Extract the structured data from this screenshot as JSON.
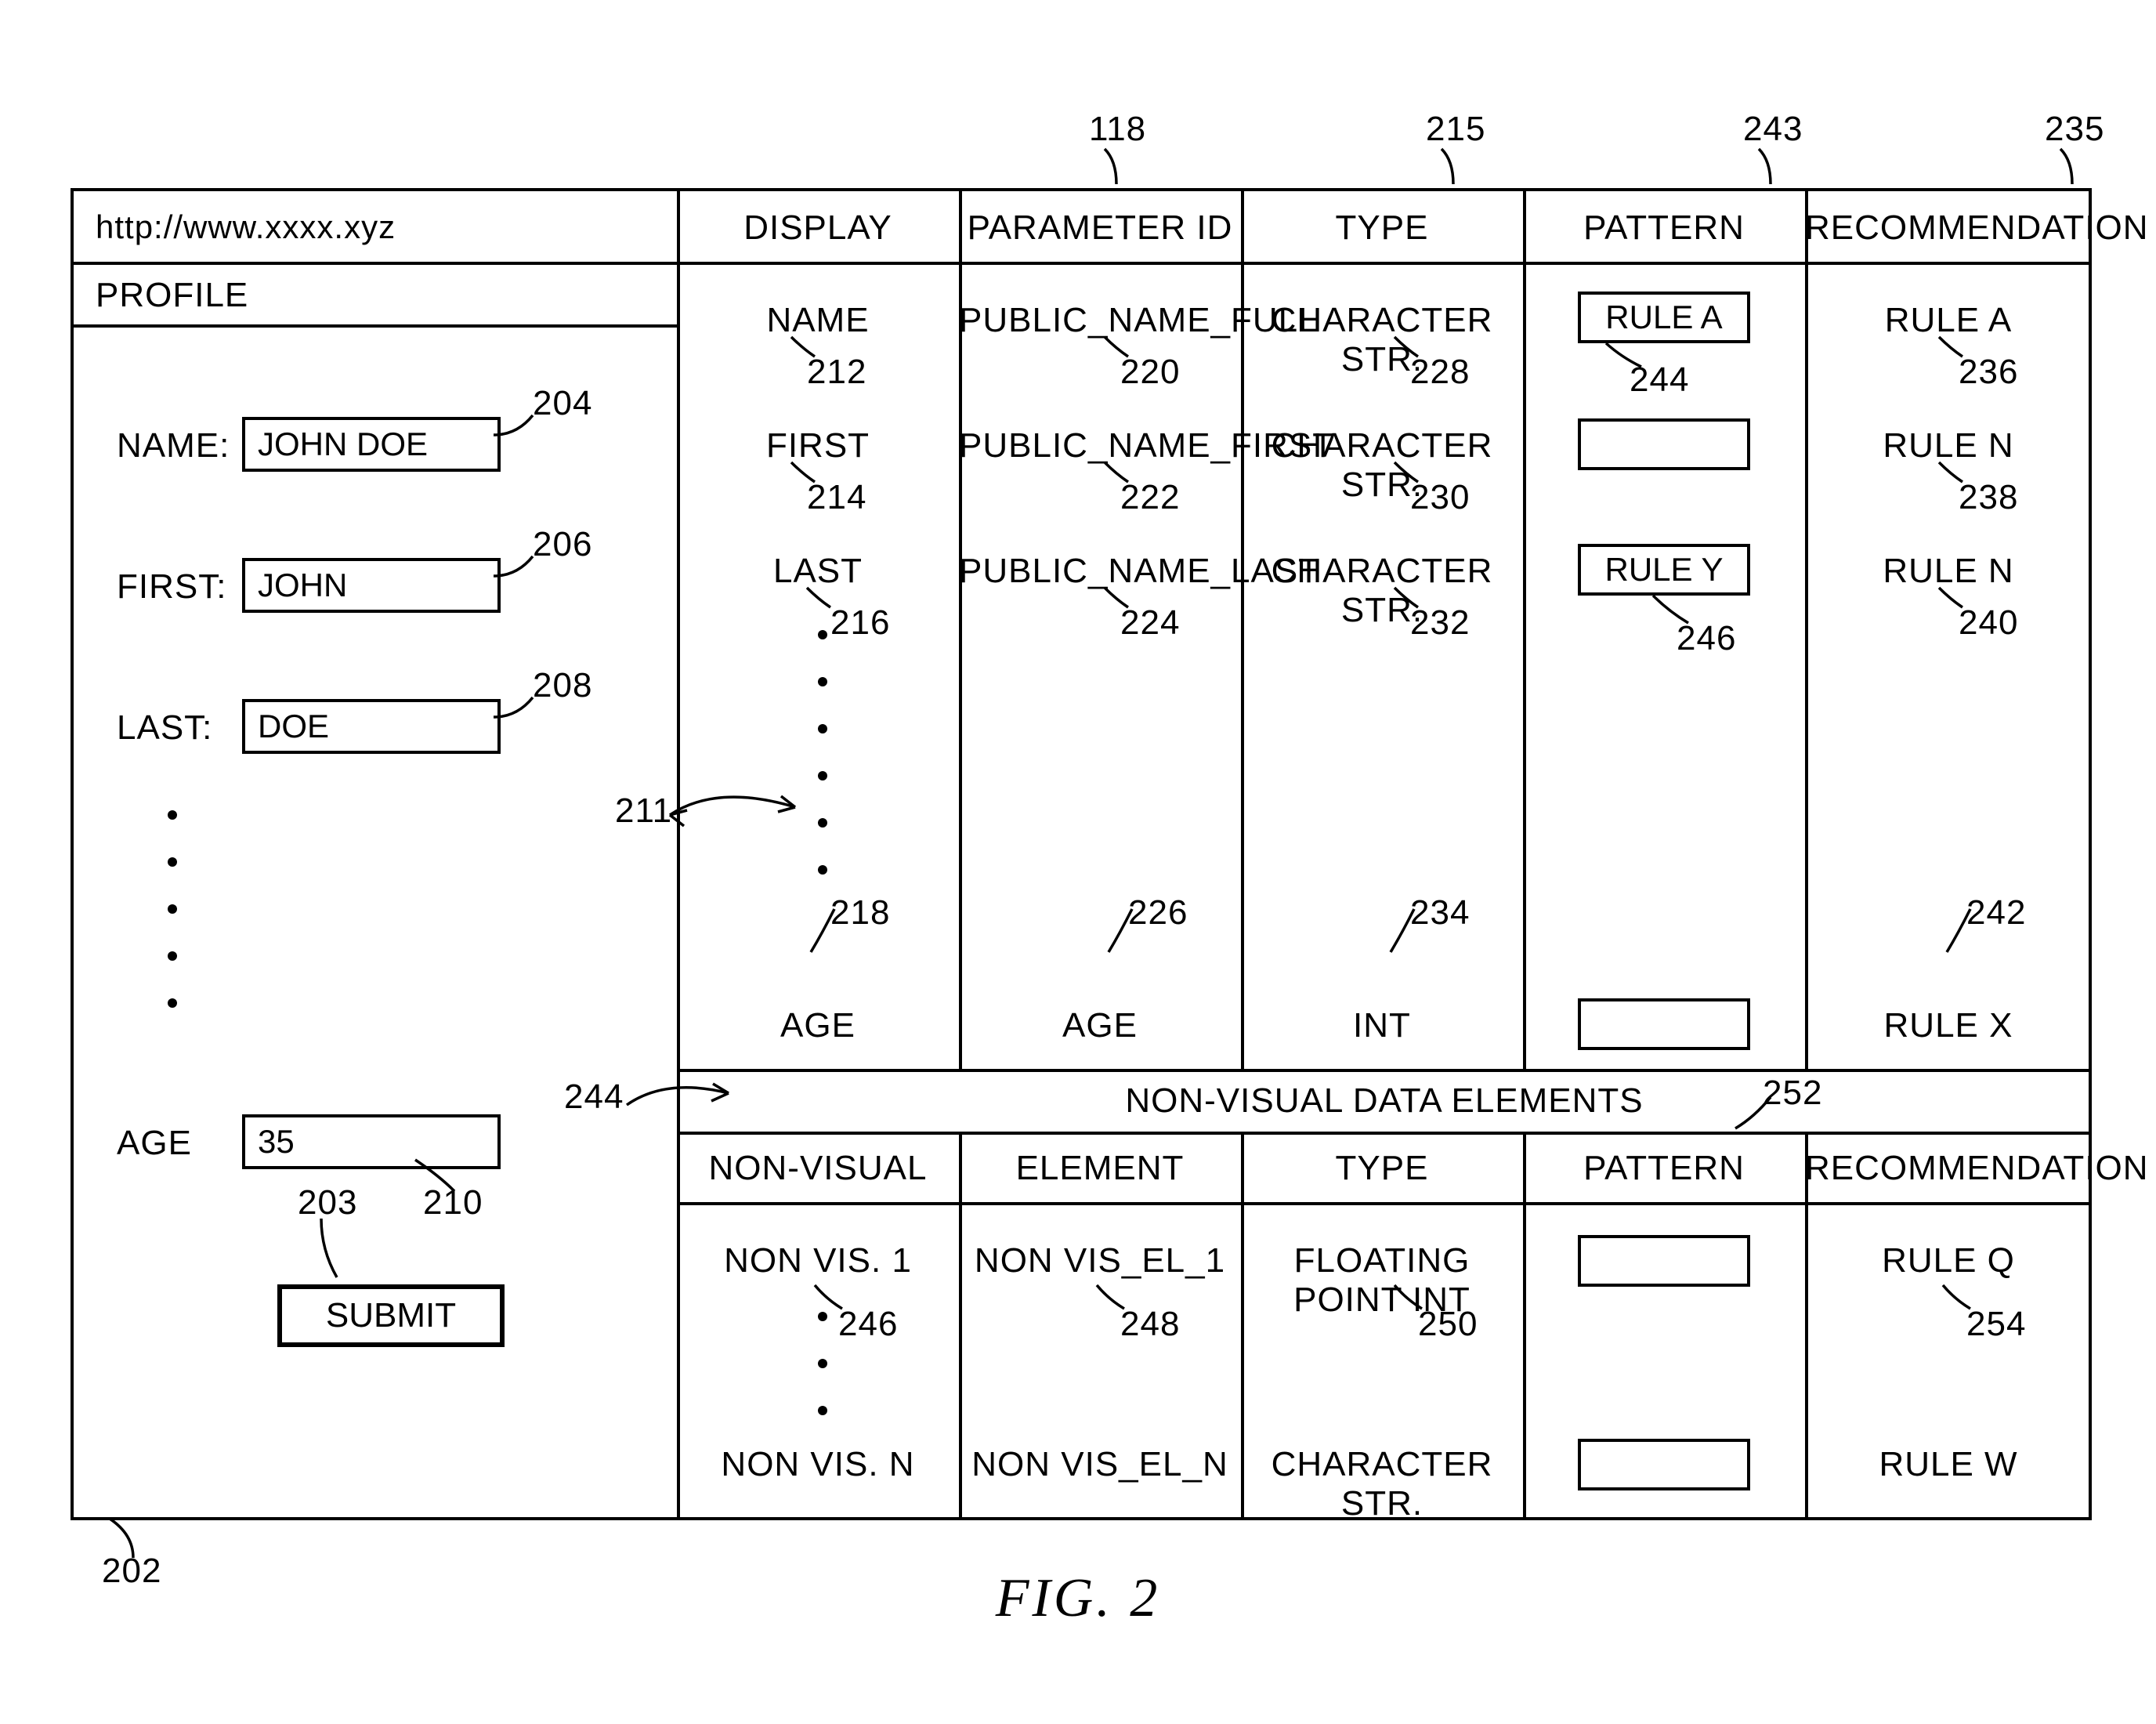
{
  "figure_label": "FIG. 2",
  "url_bar": "http://www.xxxx.xyz",
  "profile_title": "PROFILE",
  "form": {
    "name_label": "NAME:",
    "name_value": "JOHN DOE",
    "first_label": "FIRST:",
    "first_value": "JOHN",
    "last_label": "LAST:",
    "last_value": "DOE",
    "age_label": "AGE",
    "age_value": "35",
    "submit_label": "SUBMIT"
  },
  "top_table": {
    "headers": {
      "display": "DISPLAY",
      "parameter_id": "PARAMETER ID",
      "type": "TYPE",
      "pattern": "PATTERN",
      "recommendation": "RECOMMENDATION"
    },
    "rows": [
      {
        "display": "NAME",
        "param": "PUBLIC_NAME_FULL",
        "type": "CHARACTER STR.",
        "pattern": "RULE A",
        "rec": "RULE A"
      },
      {
        "display": "FIRST",
        "param": "PUBLIC_NAME_FIRST",
        "type": "CHARACTER STR.",
        "pattern": "",
        "rec": "RULE N"
      },
      {
        "display": "LAST",
        "param": "PUBLIC_NAME_LAST",
        "type": "CHARACTER STR.",
        "pattern": "RULE Y",
        "rec": "RULE N"
      },
      {
        "display": "AGE",
        "param": "AGE",
        "type": "INT",
        "pattern": "",
        "rec": "RULE X"
      }
    ]
  },
  "nonvisual": {
    "section_title": "NON-VISUAL DATA ELEMENTS",
    "headers": {
      "nonvisual": "NON-VISUAL",
      "element": "ELEMENT",
      "type": "TYPE",
      "pattern": "PATTERN",
      "recommendation": "RECOMMENDATION"
    },
    "rows": [
      {
        "nv": "NON VIS. 1",
        "el": "NON VIS_EL_1",
        "type": "FLOATING POINT INT",
        "pattern": "",
        "rec": "RULE Q"
      },
      {
        "nv": "NON VIS. N",
        "el": "NON VIS_EL_N",
        "type": "CHARACTER STR.",
        "pattern": "",
        "rec": "RULE W"
      }
    ]
  },
  "refs": {
    "r118": "118",
    "r215": "215",
    "r243": "243",
    "r235": "235",
    "r202": "202",
    "r204": "204",
    "r206": "206",
    "r208": "208",
    "r210": "210",
    "r203": "203",
    "r211": "211",
    "r212": "212",
    "r214": "214",
    "r216": "216",
    "r218": "218",
    "r220": "220",
    "r222": "222",
    "r224": "224",
    "r226": "226",
    "r228": "228",
    "r230": "230",
    "r232": "232",
    "r234": "234",
    "r236": "236",
    "r238": "238",
    "r240": "240",
    "r242": "242",
    "r244box": "244",
    "r244row": "244",
    "r246a": "246",
    "r246b": "246",
    "r248": "248",
    "r250": "250",
    "r252": "252",
    "r254": "254"
  }
}
